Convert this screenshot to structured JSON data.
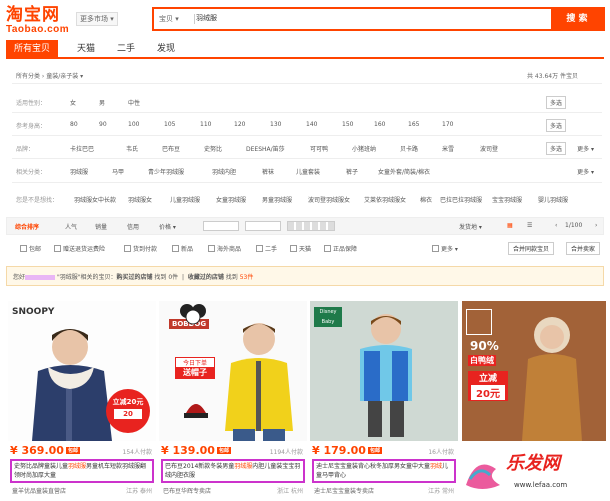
{
  "logo": {
    "cn": "淘宝网",
    "en": "Taobao.com"
  },
  "market": "更多市场",
  "search": {
    "category": "宝贝",
    "query": "羽绒服",
    "button": "搜 索"
  },
  "tabs": [
    "所有宝贝",
    "天猫",
    "二手",
    "发现"
  ],
  "breadcrumb": {
    "root": "所有分类",
    "current": "童装/亲子装"
  },
  "total_label": "共 43.64万 件宝贝",
  "filters": {
    "gender": {
      "label": "适用性别：",
      "values": [
        "女",
        "男",
        "中性"
      ],
      "multi": "多选"
    },
    "height": {
      "label": "参考身高：",
      "values": [
        "80",
        "90",
        "100",
        "105",
        "110",
        "120",
        "130",
        "140",
        "150",
        "160",
        "165",
        "170"
      ],
      "multi": "多选"
    },
    "brand": {
      "label": "品牌：",
      "values": [
        "卡拉巴巴",
        "韦氏",
        "巴布豆",
        "史努比",
        "DEESHA/笛莎",
        "可可鸭",
        "小猪班纳",
        "贝卡路",
        "米雪",
        "波司登"
      ],
      "multi": "多选",
      "more": "更多"
    },
    "related": {
      "label": "相关分类：",
      "values": [
        "羽绒服",
        "马甲",
        "青少年羽绒服",
        "羽绒内胆",
        "裤袜",
        "儿童套装",
        "裤子",
        "女童外套/简装/棉衣"
      ],
      "more": "更多"
    }
  },
  "suggest": {
    "label": "您是不是想找：",
    "values": [
      "羽绒服女中长款",
      "羽绒服女",
      "儿童羽绒服",
      "女童羽绒服",
      "男童羽绒服",
      "波司登羽绒服女",
      "艾莱依羽绒服女",
      "棉衣",
      "巴拉巴拉羽绒服",
      "宝宝羽绒服",
      "婴儿羽绒服"
    ]
  },
  "sort": {
    "items": [
      "综合排序",
      "人气",
      "销量",
      "信用",
      "价格"
    ],
    "ship": "发货地",
    "page": "1/100"
  },
  "checks": [
    "包邮",
    "赠送退货运费险",
    "货到付款",
    "新品",
    "海外商品",
    "二手",
    "天猫",
    "正品保障"
  ],
  "check_more": "更多",
  "merge_buttons": [
    "合并同款宝贝",
    "合并卖家"
  ],
  "notice": {
    "prefix": "您好",
    "mid": "\"羽绒服\"相关的宝贝：",
    "ratio": "购买过的店铺",
    "found": "找到",
    "count1": "0",
    "unit1": "件",
    "sep": "收藏过的店铺",
    "found2": "找到",
    "count2": "53件"
  },
  "products": [
    {
      "price": "¥ 369.00",
      "pays": "154人付款",
      "title_pre": "史努比品牌童装儿童",
      "kw": "羽绒服",
      "title_post": "男童机车短款羽绒服翻领时尚加厚大童",
      "shop": "童羊优品童装直营店",
      "loc": "江苏 泰州",
      "brand": "SNOOPY",
      "promo1": "立减20元",
      "promo2": "20"
    },
    {
      "price": "¥ 139.00",
      "pays": "1194人付款",
      "title_pre": "巴布豆2014新款冬装男童",
      "kw": "羽绒服",
      "title_post": "内胆儿童装宝宝羽绒内胆衣服",
      "shop": "巴布豆华辉专卖店",
      "loc": "浙江 杭州",
      "brand": "BOBDOG",
      "promo1": "今日下单",
      "promo2": "送帽子"
    },
    {
      "price": "¥ 179.00",
      "pays": "16人付款",
      "title_pre": "迪士尼宝宝童装背心秋冬加厚男女童中大童",
      "kw": "羽绒",
      "title_post": "儿童马甲背心",
      "shop": "迪士尼宝宝童装专卖店",
      "loc": "江苏 常州",
      "brand": "Disney Baby"
    },
    {
      "price": "",
      "pays": "",
      "title_pre": "",
      "kw": "",
      "title_post": "",
      "shop": "",
      "loc": "",
      "brand": "",
      "promo1": "90%",
      "promo2": "白鸭绒",
      "promo3": "立减",
      "promo4": "20元"
    }
  ],
  "watermark": {
    "text": "乐发网",
    "url": "www.lefaa.com"
  }
}
